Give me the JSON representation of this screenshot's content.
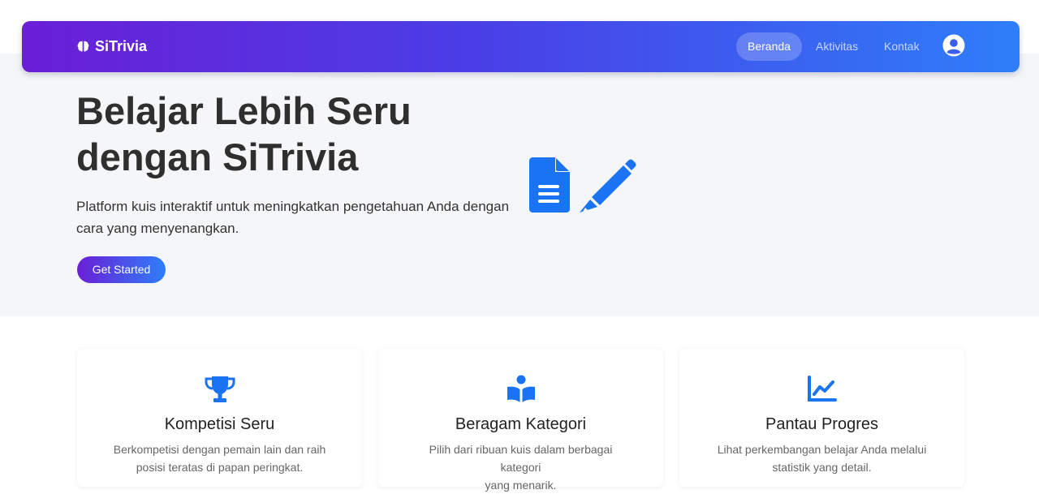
{
  "brand": {
    "name": "SiTrivia",
    "icon": "brain-icon"
  },
  "nav": {
    "items": [
      {
        "label": "Beranda",
        "active": true
      },
      {
        "label": "Aktivitas",
        "active": false
      },
      {
        "label": "Kontak",
        "active": false
      }
    ],
    "profile_icon": "user-circle-icon"
  },
  "hero": {
    "title_line1": "Belajar Lebih Seru",
    "title_line2": "dengan SiTrivia",
    "subtitle_line1": "Platform kuis interaktif untuk meningkatkan pengetahuan Anda dengan",
    "subtitle_line2": "cara yang menyenangkan.",
    "cta_label": "Get Started",
    "icons": [
      "document-icon",
      "pencil-icon"
    ]
  },
  "features": [
    {
      "icon": "trophy-icon",
      "title": "Kompetisi Seru",
      "desc_line1": "Berkompetisi dengan pemain lain dan raih",
      "desc_line2": "posisi teratas di papan peringkat."
    },
    {
      "icon": "book-reader-icon",
      "title": "Beragam Kategori",
      "desc_line1": "Pilih dari ribuan kuis dalam berbagai kategori",
      "desc_line2": "yang menarik."
    },
    {
      "icon": "chart-line-icon",
      "title": "Pantau Progres",
      "desc_line1": "Lihat perkembangan belajar Anda melalui",
      "desc_line2": "statistik yang detail."
    }
  ],
  "colors": {
    "accent": "#1a73f2",
    "gradient_start": "#6a1fd6",
    "gradient_end": "#2e7ef9",
    "hero_bg": "#f5f6f8"
  }
}
